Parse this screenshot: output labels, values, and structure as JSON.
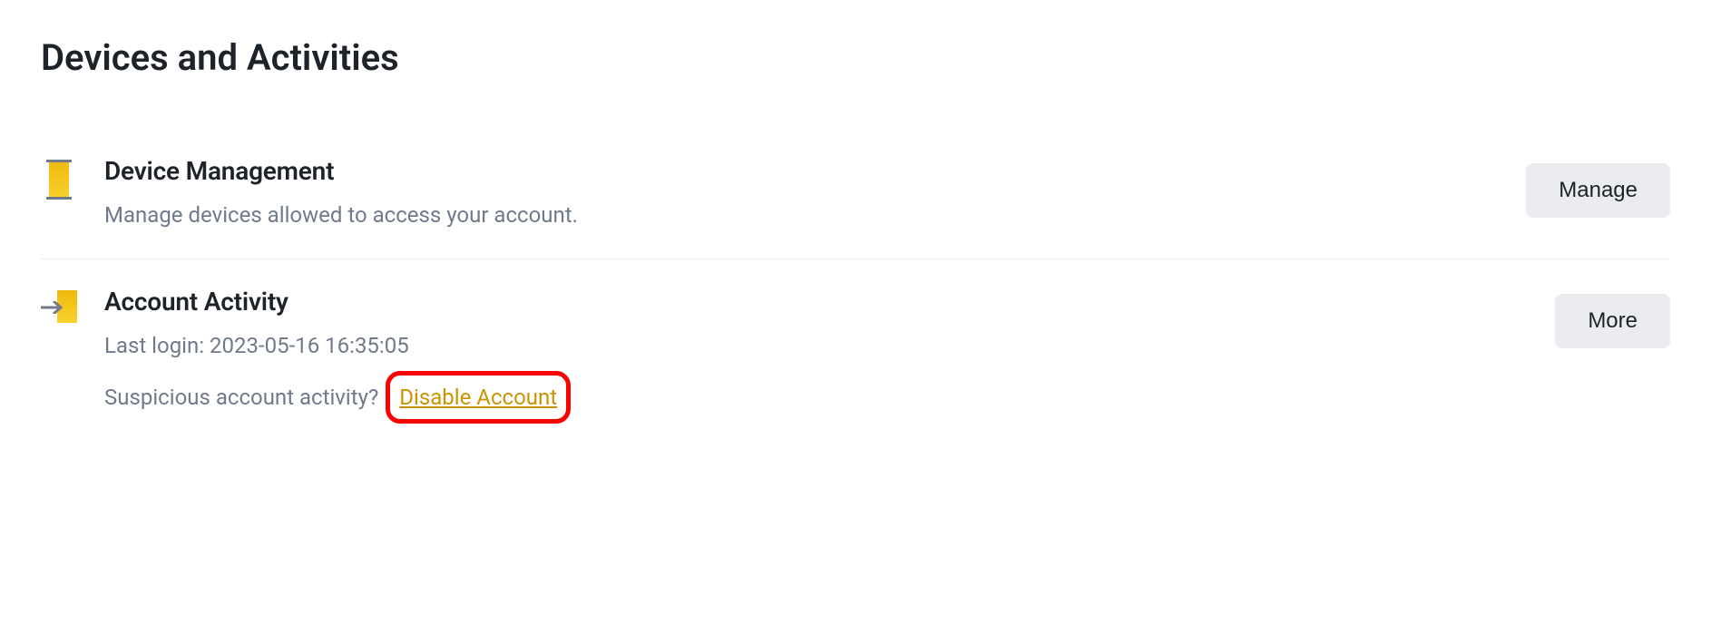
{
  "section": {
    "title": "Devices and Activities"
  },
  "rows": {
    "device": {
      "title": "Device Management",
      "desc": "Manage devices allowed to access your account.",
      "button": "Manage"
    },
    "activity": {
      "title": "Account Activity",
      "lastLogin": "Last login: 2023-05-16 16:35:05",
      "suspiciousPrefix": "Suspicious account activity? ",
      "disableLink": "Disable Account",
      "button": "More"
    }
  }
}
